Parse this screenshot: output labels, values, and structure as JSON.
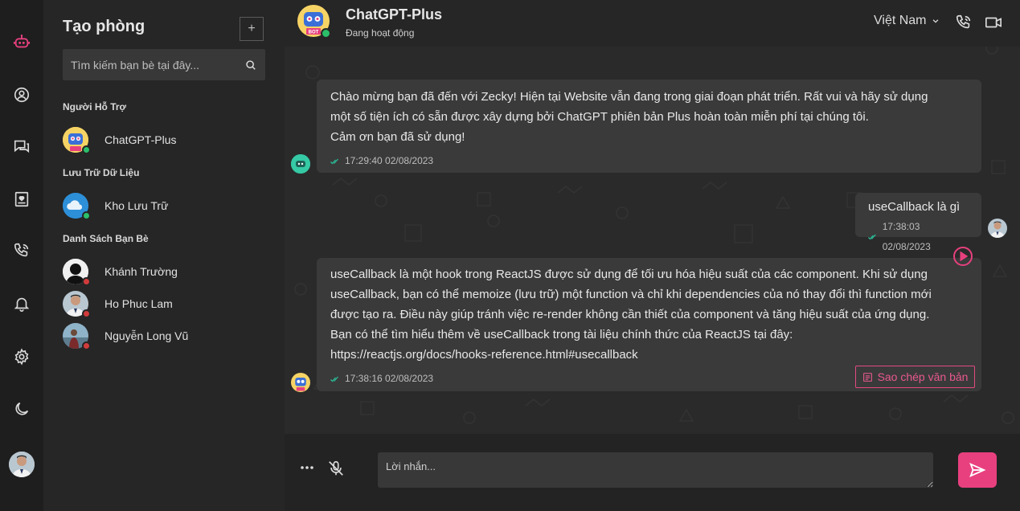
{
  "rail": {
    "items": [
      {
        "icon": "robot-logo-icon"
      },
      {
        "icon": "user-profile-icon"
      },
      {
        "icon": "chat-icon"
      },
      {
        "icon": "contacts-book-icon"
      },
      {
        "icon": "phone-call-icon"
      },
      {
        "icon": "bell-icon"
      },
      {
        "icon": "gear-icon"
      },
      {
        "icon": "moon-icon"
      }
    ]
  },
  "sidebar": {
    "title": "Tạo phòng",
    "add_label": "+",
    "search_placeholder": "Tìm kiếm bạn bè tại đây...",
    "sections": [
      {
        "title": "Người Hỗ Trợ",
        "contacts": [
          {
            "name": "ChatGPT-Plus",
            "status": "online"
          }
        ]
      },
      {
        "title": "Lưu Trữ Dữ Liệu",
        "contacts": [
          {
            "name": "Kho Lưu Trữ",
            "status": "online"
          }
        ]
      },
      {
        "title": "Danh Sách Bạn Bè",
        "contacts": [
          {
            "name": "Khánh Trường",
            "status": "offline"
          },
          {
            "name": "Ho Phuc Lam",
            "status": "offline"
          },
          {
            "name": "Nguyễn Long Vũ",
            "status": "offline"
          }
        ]
      }
    ]
  },
  "header": {
    "name": "ChatGPT-Plus",
    "status": "Đang hoạt động",
    "language": "Việt Nam",
    "bot_badge": "BOT"
  },
  "messages": [
    {
      "from": "bot",
      "text": "Chào mừng bạn đã đến với Zecky! Hiện tại Website vẫn đang trong giai đoạn phát triển. Rất vui và hãy sử dụng\nmột số tiện ích có sẵn được xây dựng bởi ChatGPT phiên bản Plus hoàn toàn miễn phí tại chúng tôi.\n Cảm ơn bạn đã sử dụng!",
      "time": "17:29:40 02/08/2023"
    },
    {
      "from": "me",
      "text": "useCallback là gì",
      "time": "17:38:03 02/08/2023"
    },
    {
      "from": "bot",
      "text": "useCallback là một hook trong ReactJS được sử dụng để tối ưu hóa hiệu suất của các component. Khi sử dụng\nuseCallback, bạn có thể memoize (lưu trữ) một function và chỉ khi dependencies của nó thay đổi thì function mới\nđược tạo ra. Điều này giúp tránh việc re-render không cần thiết của component và tăng hiệu suất của ứng dụng.\nBạn có thể tìm hiểu thêm về useCallback trong tài liệu chính thức của ReactJS tại đây:\nhttps://reactjs.org/docs/hooks-reference.html#usecallback",
      "time": "17:38:16 02/08/2023",
      "copy_label": "Sao chép văn bản"
    }
  ],
  "composer": {
    "placeholder": "Lời nhắn..."
  },
  "colors": {
    "accent": "#e8407e",
    "online": "#2bbf6a",
    "offline": "#d23b3b",
    "read_tick": "#2bbf9a"
  }
}
